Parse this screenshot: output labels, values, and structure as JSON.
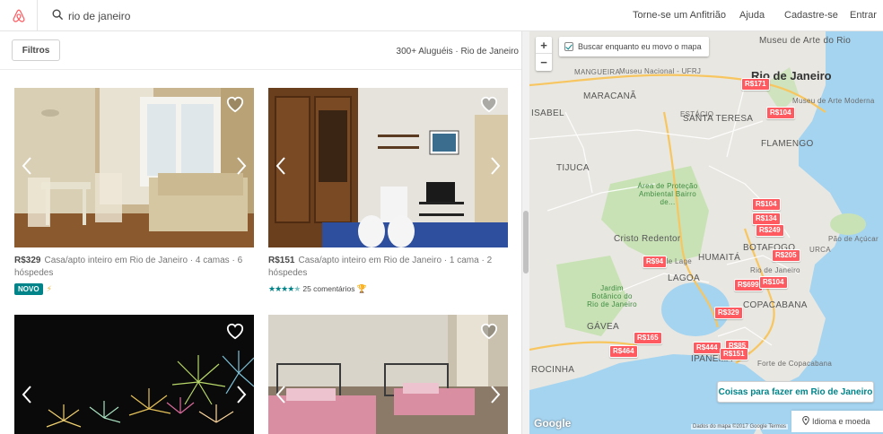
{
  "header": {
    "search_value": "rio de janeiro",
    "nav": [
      "Torne-se um Anfitrião",
      "Ajuda",
      "Cadastre-se",
      "Entrar"
    ]
  },
  "listings_panel": {
    "filter_label": "Filtros",
    "results_count": "300+ Aluguéis · Rio de Janeiro"
  },
  "listings": [
    {
      "price": "R$329",
      "desc": "Casa/apto inteiro em Rio de Janeiro · 4 camas · 6 hóspedes",
      "badge": "NOVO"
    },
    {
      "price": "R$151",
      "desc": "Casa/apto inteiro em Rio de Janeiro · 1 cama · 2 hóspedes",
      "rating_stars": 4.5,
      "reviews": "25 comentários"
    },
    {
      "price": "",
      "desc": ""
    },
    {
      "price": "",
      "desc": ""
    }
  ],
  "map": {
    "search_as_move": "Buscar enquanto eu movo o mapa",
    "zoom_in": "+",
    "zoom_out": "−",
    "labels": {
      "city": "Rio de Janeiro",
      "museu_arte_rio": "Museu de Arte do Rio",
      "museu_arte_moderna": "Museu de Arte Moderna",
      "museu_nacional": "Museu Nacional - UFRJ",
      "maracana": "MARACANÃ",
      "mangueira": "MANGUEIRA",
      "isabel": "ISABEL",
      "santa_teresa": "SANTA TERESA",
      "estacio": "ESTÁCIO",
      "tijuca": "TIJUCA",
      "flamengo": "FLAMENGO",
      "area_protecao": "Área de Proteção Ambiental Bairro de...",
      "cristo": "Cristo Redentor",
      "botafogo": "BOTAFOGO",
      "urca": "URCA",
      "pao_acucar": "Pão de Açúcar",
      "humaita": "HUMAITÁ",
      "lagoa": "LAGOA",
      "jardim_botanico": "Jardim Botânico do Rio de Janeiro",
      "copacabana": "COPACABANA",
      "gavea": "GÁVEA",
      "ipanema": "IPANEMA",
      "rocinha": "ROCINHA",
      "forte": "Forte de Copacabana",
      "de_lage": "de Lage",
      "rio_janeiro_small": "Rio de Janeiro"
    },
    "markers": [
      "R$171",
      "R$104",
      "R$104",
      "R$134",
      "R$249",
      "R$205",
      "R$94",
      "R$699",
      "R$104",
      "R$329",
      "R$165",
      "R$444",
      "R$85",
      "R$151",
      "R$464"
    ],
    "things_to_do": "Coisas para fazer em Rio de Janeiro",
    "language_currency": "Idioma e moeda",
    "google": "Google",
    "attribution": "Dados do mapa ©2017 Google   Termos"
  },
  "colors": {
    "brand": "#ff5a5f",
    "accent_teal": "#008489",
    "water": "#a5d4f0",
    "park": "#c8e2b6"
  },
  "icons": [
    "airbnb-logo-icon",
    "search-icon",
    "heart-icon",
    "chevron-left-icon",
    "chevron-right-icon",
    "lightning-icon",
    "trophy-icon",
    "pin-icon"
  ]
}
